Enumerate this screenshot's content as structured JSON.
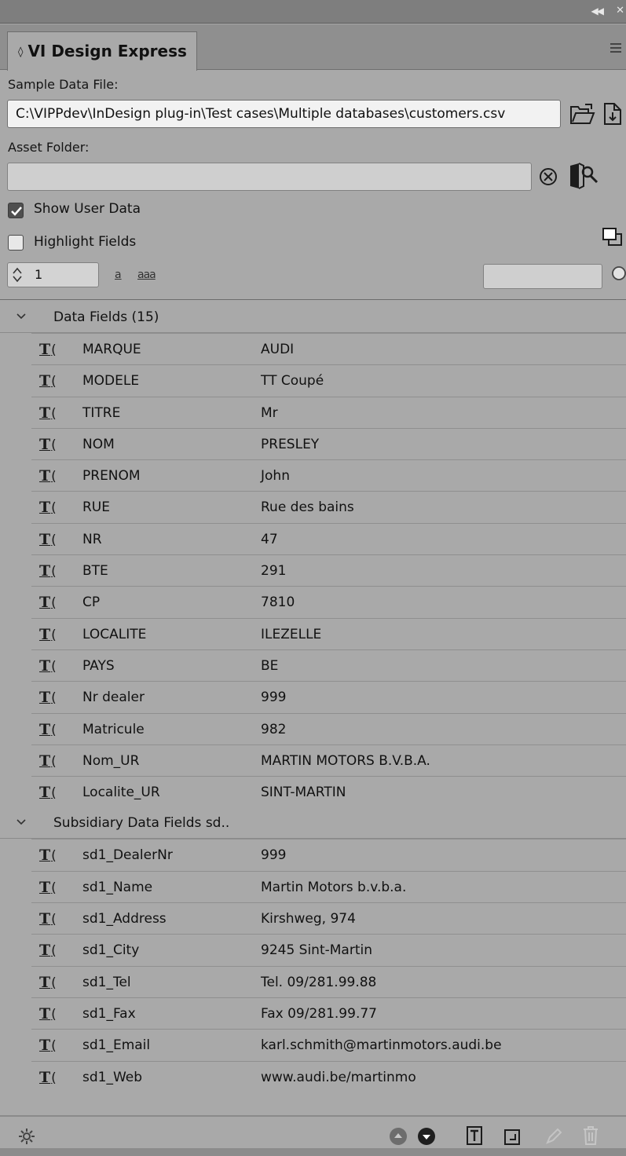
{
  "panel": {
    "tab_title": "VI Design Express"
  },
  "sample_data": {
    "label": "Sample Data File:",
    "path": "C:\\VIPPdev\\InDesign plug-in\\Test cases\\Multiple databases\\customers.csv"
  },
  "asset_folder": {
    "label": "Asset Folder:",
    "value": ""
  },
  "options": {
    "show_user_data": {
      "label": "Show User Data",
      "checked": true
    },
    "highlight_fields": {
      "label": "Highlight Fields",
      "checked": false
    }
  },
  "record": {
    "number": "1",
    "match_case_a": "a",
    "match_case_aaa": "aaa",
    "search_value": ""
  },
  "groups": [
    {
      "name": "Data Fields (15)",
      "fields": [
        {
          "name": "MARQUE",
          "value": "AUDI"
        },
        {
          "name": "MODELE",
          "value": "TT Coupé"
        },
        {
          "name": "TITRE",
          "value": "Mr"
        },
        {
          "name": "NOM",
          "value": "PRESLEY"
        },
        {
          "name": "PRENOM",
          "value": "John"
        },
        {
          "name": "RUE",
          "value": "Rue des bains"
        },
        {
          "name": "NR",
          "value": "47"
        },
        {
          "name": "BTE",
          "value": "291"
        },
        {
          "name": "CP",
          "value": "7810"
        },
        {
          "name": "LOCALITE",
          "value": "ILEZELLE"
        },
        {
          "name": "PAYS",
          "value": "BE"
        },
        {
          "name": "Nr dealer",
          "value": "999"
        },
        {
          "name": "Matricule",
          "value": "982"
        },
        {
          "name": "Nom_UR",
          "value": "MARTIN MOTORS B.V.B.A."
        },
        {
          "name": "Localite_UR",
          "value": "SINT-MARTIN"
        }
      ]
    },
    {
      "name": "Subsidiary Data Fields sd..",
      "fields": [
        {
          "name": "sd1_DealerNr",
          "value": "999"
        },
        {
          "name": "sd1_Name",
          "value": "Martin Motors b.v.b.a."
        },
        {
          "name": "sd1_Address",
          "value": "Kirshweg, 974"
        },
        {
          "name": "sd1_City",
          "value": "9245 Sint-Martin"
        },
        {
          "name": "sd1_Tel",
          "value": "Tel. 09/281.99.88"
        },
        {
          "name": "sd1_Fax",
          "value": "Fax 09/281.99.77"
        },
        {
          "name": "sd1_Email",
          "value": "karl.schmith@martinmotors.audi.be"
        },
        {
          "name": "sd1_Web",
          "value": "www.audi.be/martinmo"
        }
      ]
    }
  ],
  "icons": {
    "tab_arrows": "sort-arrows-icon",
    "open_folder": "open-folder-icon",
    "new_file": "new-file-icon",
    "clear": "clear-icon",
    "browse_folder": "browse-folder-icon",
    "highlight_color": "color-swatch-icon",
    "field_type": "text-field-icon",
    "settings": "gear-icon",
    "move_up": "move-up-icon",
    "move_down": "move-down-icon",
    "insert_field": "insert-text-field-icon",
    "insert_image": "insert-image-field-icon",
    "edit": "edit-icon",
    "delete": "trash-icon"
  },
  "colors": {
    "panel_bg": "#a9a9a9",
    "header_bg": "#7e7e7e",
    "field_bg": "#f2f2f2"
  }
}
